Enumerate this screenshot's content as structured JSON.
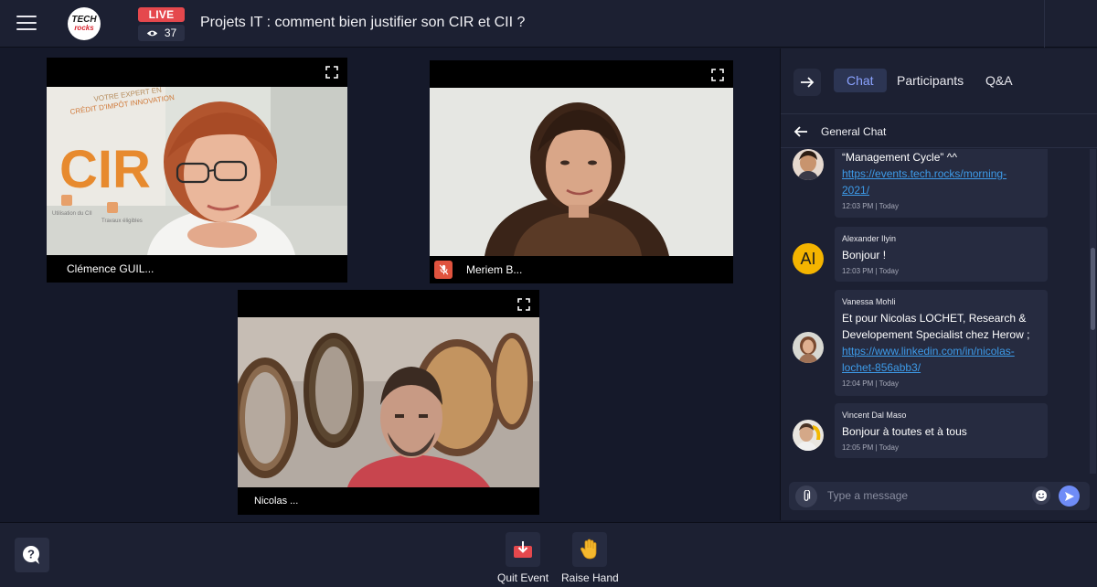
{
  "header": {
    "live_label": "LIVE",
    "viewer_count": "37",
    "title": "Projets IT : comment bien justifier son CIR et CII ?",
    "logo_line1": "TECH",
    "logo_line2": "rocks"
  },
  "stage": {
    "participants": [
      {
        "name": "Clémence GUIL...",
        "muted": false
      },
      {
        "name": "Meriem B...",
        "muted": true
      },
      {
        "name": "Nicolas ..."
      }
    ],
    "banner": {
      "line1": "VOTRE EXPERT EN",
      "line2": "CRÉDIT D'IMPÔT INNOVATION",
      "big": "CIR",
      "caption1": "Utilisation du CII",
      "caption2": "Travaux éligibles"
    }
  },
  "panel": {
    "tabs": [
      "Chat",
      "Participants",
      "Q&A"
    ],
    "active_tab": "Chat",
    "chat_title": "General Chat",
    "messages": [
      {
        "author": "",
        "text": "“Management Cycle” ^^",
        "link": "https://events.tech.rocks/morning-2021/",
        "link_l1": "https://events.tech.rocks/morning-",
        "link_l2": "2021/",
        "time": "12:03 PM | Today"
      },
      {
        "author": "Alexander Ilyin",
        "initials": "AI",
        "text": "Bonjour !",
        "time": "12:03 PM | Today"
      },
      {
        "author": "Vanessa Mohli",
        "text_l1": "Et pour Nicolas LOCHET, Research &",
        "text_l2": "Developement Specialist chez Herow ;",
        "link_l1": "https://www.linkedin.com/in/nicolas-",
        "link_l2": "lochet-856abb3/",
        "time": "12:04 PM | Today"
      },
      {
        "author": "Vincent Dal Maso",
        "text": "Bonjour à toutes et à tous",
        "time": "12:05 PM | Today"
      }
    ],
    "compose_placeholder": "Type a message"
  },
  "footer": {
    "quit_label": "Quit Event",
    "raise_label": "Raise Hand"
  },
  "colors": {
    "live": "#e5484d",
    "accent": "#6f8cf7",
    "link": "#3d9be9",
    "mute": "#e0533e"
  }
}
